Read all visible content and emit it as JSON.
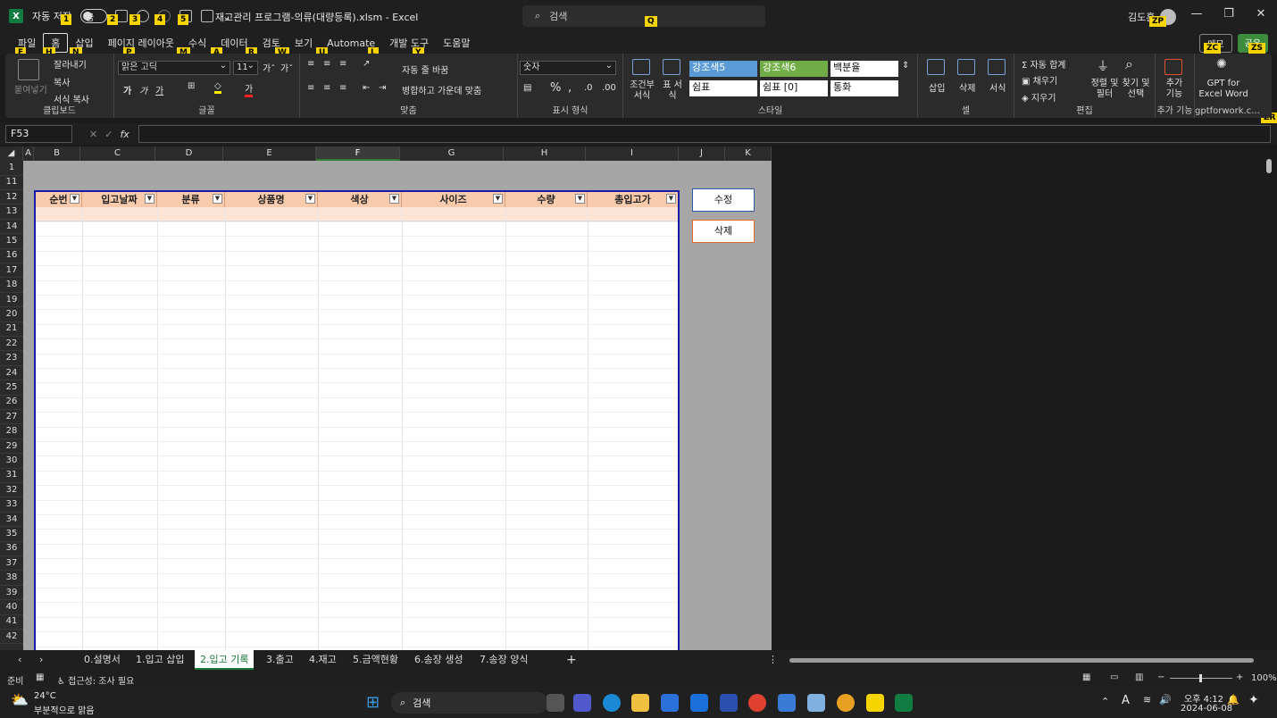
{
  "titlebar": {
    "autosave_label": "자동 저장",
    "toggle_state": "끔",
    "doc_title": "재고관리 프로그램-의류(대량등록).xlsm  -  Excel",
    "search_placeholder": "검색",
    "user_name": "김도훈",
    "keytips": [
      "1",
      "2",
      "3",
      "4",
      "5",
      "Q",
      "ZP"
    ]
  },
  "menu": {
    "tabs": [
      "파일",
      "홈",
      "삽입",
      "페이지 레이아웃",
      "수식",
      "데이터",
      "검토",
      "보기",
      "Automate",
      "개발 도구",
      "도움말"
    ],
    "tab_keytips": [
      "F",
      "H",
      "N",
      "P",
      "M",
      "A",
      "R",
      "W",
      "U",
      "L",
      "Y"
    ],
    "memo": "메모",
    "share": "공유",
    "right_keytips": [
      "ZC",
      "ZS",
      "ZR"
    ]
  },
  "ribbon": {
    "clipboard": {
      "paste": "붙여넣기",
      "cut": "잘라내기",
      "copy": "복사",
      "format_painter": "서식 복사",
      "group": "클립보드"
    },
    "font": {
      "name": "맑은 고딕",
      "size": "11",
      "group": "글꼴",
      "bold": "가",
      "italic": "가",
      "underline": "가"
    },
    "align": {
      "wrap": "자동 줄 바꿈",
      "merge": "병합하고 가운데 맞춤",
      "group": "맞춤"
    },
    "number": {
      "format": "숫자",
      "group": "표시 형식"
    },
    "styles": {
      "conditional": "조건부 서식",
      "table": "표 서식",
      "cells": [
        "강조색5",
        "강조색6",
        "백분율",
        "쉼표",
        "쉼표 [0]",
        "통화"
      ],
      "group": "스타일"
    },
    "cells": {
      "insert": "삽입",
      "delete": "삭제",
      "format": "서식",
      "group": "셀"
    },
    "editing": {
      "autosum": "자동 합계",
      "fill": "채우기",
      "clear": "지우기",
      "sort": "정렬 및 필터",
      "find": "찾기 및 선택",
      "group": "편집"
    },
    "addins": {
      "addin": "추가 기능",
      "group": "추가 기능"
    },
    "gpt": {
      "label": "GPT for Excel Word",
      "group": "gptforwork.c..."
    }
  },
  "formula": {
    "namebox": "F53",
    "fx": "fx"
  },
  "grid": {
    "columns": [
      "A",
      "B",
      "C",
      "D",
      "E",
      "F",
      "G",
      "H",
      "I",
      "J",
      "K"
    ],
    "rows": [
      "1",
      "11",
      "12",
      "13",
      "14",
      "15",
      "16",
      "17",
      "18",
      "19",
      "20",
      "21",
      "22",
      "23",
      "24",
      "25",
      "26",
      "27",
      "28",
      "29",
      "30",
      "31",
      "32",
      "33",
      "34",
      "35",
      "36",
      "37",
      "38",
      "39",
      "40",
      "41",
      "42"
    ],
    "table_headers": [
      "순번",
      "입고날짜",
      "분류",
      "상품명",
      "색상",
      "사이즈",
      "수량",
      "총입고가"
    ],
    "buttons": {
      "edit": "수정",
      "delete": "삭제"
    }
  },
  "sheets": {
    "tabs": [
      "0.설명서",
      "1.입고 삽입",
      "2.입고 기록",
      "3.출고",
      "4.재고",
      "5.금액현황",
      "6.송장 생성",
      "7.송장 양식"
    ],
    "active": "2.입고 기록"
  },
  "status": {
    "ready": "준비",
    "accessibility": "접근성: 조사 필요",
    "zoom": "100%"
  },
  "taskbar": {
    "weather_temp": "24°C",
    "weather_desc": "부분적으로 맑음",
    "search": "검색",
    "time": "오후 4:12",
    "date": "2024-06-08"
  }
}
